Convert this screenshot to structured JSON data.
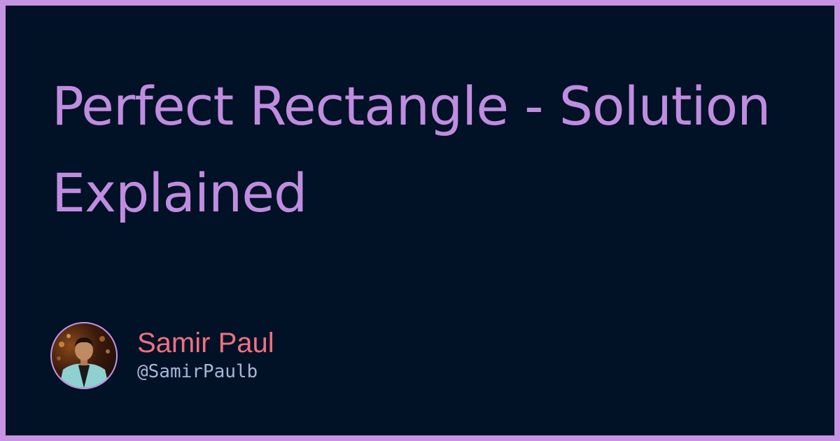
{
  "post": {
    "title": "Perfect Rectangle - Solution Explained"
  },
  "author": {
    "name": "Samir Paul",
    "handle": "@SamirPaulb"
  },
  "colors": {
    "border": "#c594e3",
    "background": "#021226",
    "title": "#c08ce0",
    "author_name": "#ee7180",
    "author_handle": "#a7b6d8"
  }
}
